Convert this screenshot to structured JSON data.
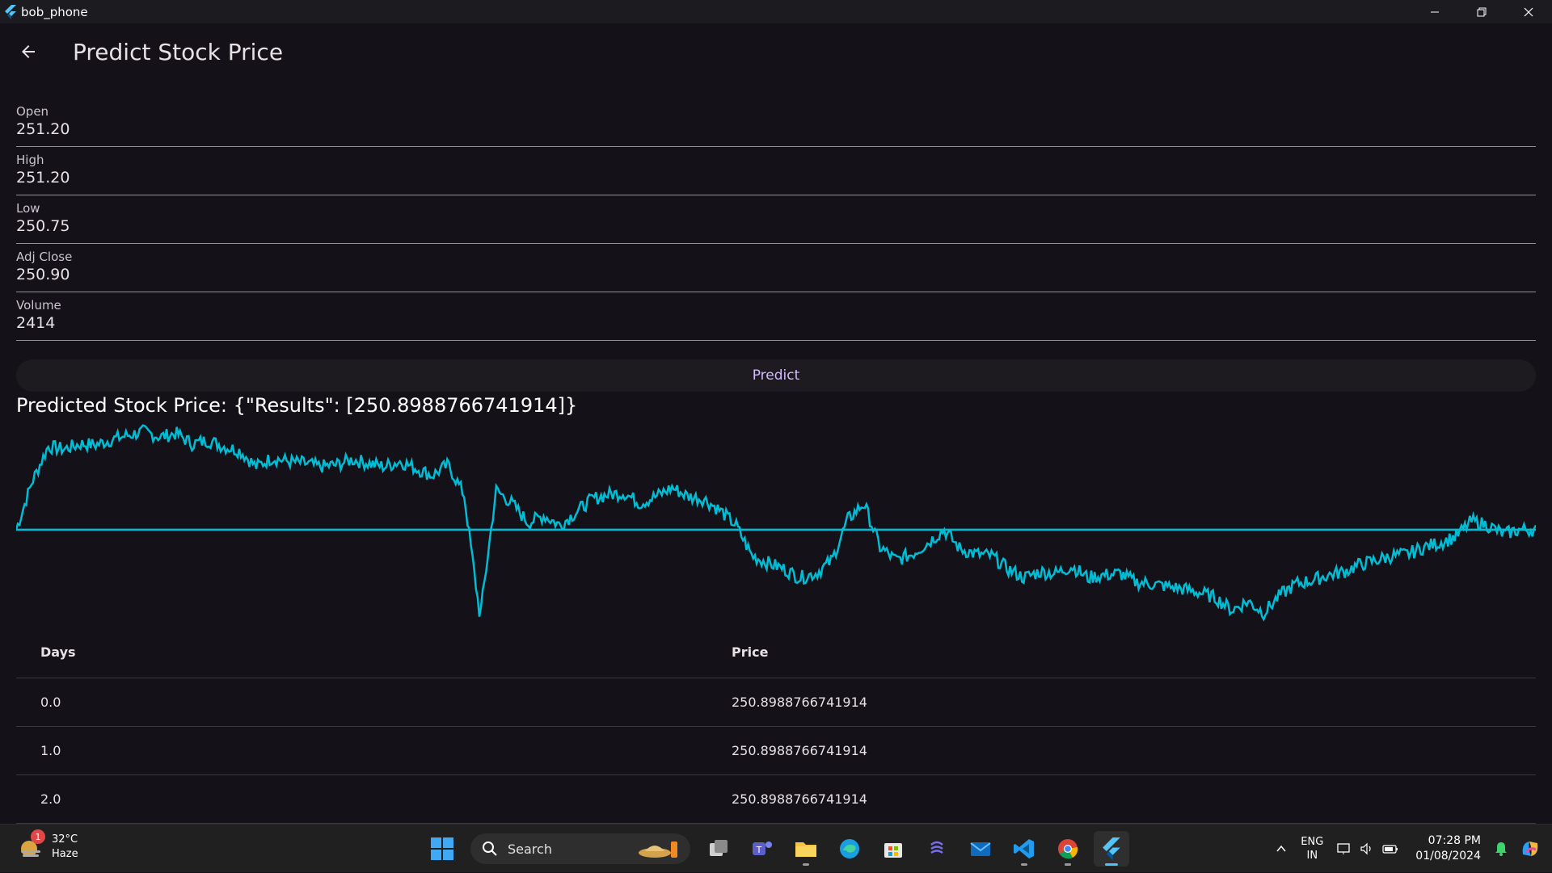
{
  "window": {
    "title": "bob_phone"
  },
  "appbar": {
    "title": "Predict Stock Price"
  },
  "fields": [
    {
      "label": "Open",
      "value": "251.20"
    },
    {
      "label": "High",
      "value": "251.20"
    },
    {
      "label": "Low",
      "value": "250.75"
    },
    {
      "label": "Adj Close",
      "value": "250.90"
    },
    {
      "label": "Volume",
      "value": "2414"
    }
  ],
  "predict": {
    "label": "Predict"
  },
  "result": {
    "text": "Predicted Stock Price: {\"Results\": [250.8988766741914]}"
  },
  "colors": {
    "accent": "#00bcd4",
    "button_text": "#d0bcff",
    "background": "#141218"
  },
  "chart_data": {
    "type": "line",
    "title": "",
    "xlabel": "",
    "ylabel": "",
    "grid": false,
    "legend": "none",
    "series": [
      {
        "name": "",
        "values": [
          0.0,
          0.55,
          0.95,
          0.92,
          0.98,
          0.97,
          1.03,
          1.08,
          1.12,
          1.06,
          1.1,
          0.98,
          1.02,
          0.95,
          0.9,
          0.72,
          0.82,
          0.78,
          0.76,
          0.72,
          0.74,
          0.8,
          0.76,
          0.72,
          0.78,
          0.7,
          0.62,
          0.74,
          0.4,
          -1.0,
          0.45,
          0.3,
          0.08,
          0.16,
          0.05,
          0.2,
          0.35,
          0.4,
          0.42,
          0.3,
          0.38,
          0.48,
          0.38,
          0.35,
          0.22,
          0.05,
          -0.3,
          -0.38,
          -0.45,
          -0.55,
          -0.5,
          -0.35,
          0.12,
          0.3,
          -0.2,
          -0.35,
          -0.28,
          -0.15,
          0.0,
          -0.22,
          -0.28,
          -0.3,
          -0.45,
          -0.55,
          -0.48,
          -0.5,
          -0.42,
          -0.55,
          -0.52,
          -0.5,
          -0.6,
          -0.62,
          -0.65,
          -0.68,
          -0.72,
          -0.78,
          -0.92,
          -0.82,
          -0.95,
          -0.75,
          -0.62,
          -0.58,
          -0.52,
          -0.48,
          -0.4,
          -0.35,
          -0.3,
          -0.28,
          -0.2,
          -0.15,
          -0.08,
          0.1,
          0.05,
          -0.05,
          0.0,
          0.0
        ]
      },
      {
        "name": "",
        "values": [
          250.8988766741914,
          250.8988766741914
        ]
      }
    ],
    "y_range": [
      -1.1,
      1.3
    ]
  },
  "table": {
    "headers": {
      "days": "Days",
      "price": "Price"
    },
    "rows": [
      {
        "days": "0.0",
        "price": "250.8988766741914"
      },
      {
        "days": "1.0",
        "price": "250.8988766741914"
      },
      {
        "days": "2.0",
        "price": "250.8988766741914"
      }
    ]
  },
  "taskbar": {
    "weather": {
      "temp": "32°C",
      "condition": "Haze",
      "badge": "1"
    },
    "search_label": "Search",
    "lang_top": "ENG",
    "lang_bottom": "IN",
    "time": "07:28 PM",
    "date": "01/08/2024"
  }
}
